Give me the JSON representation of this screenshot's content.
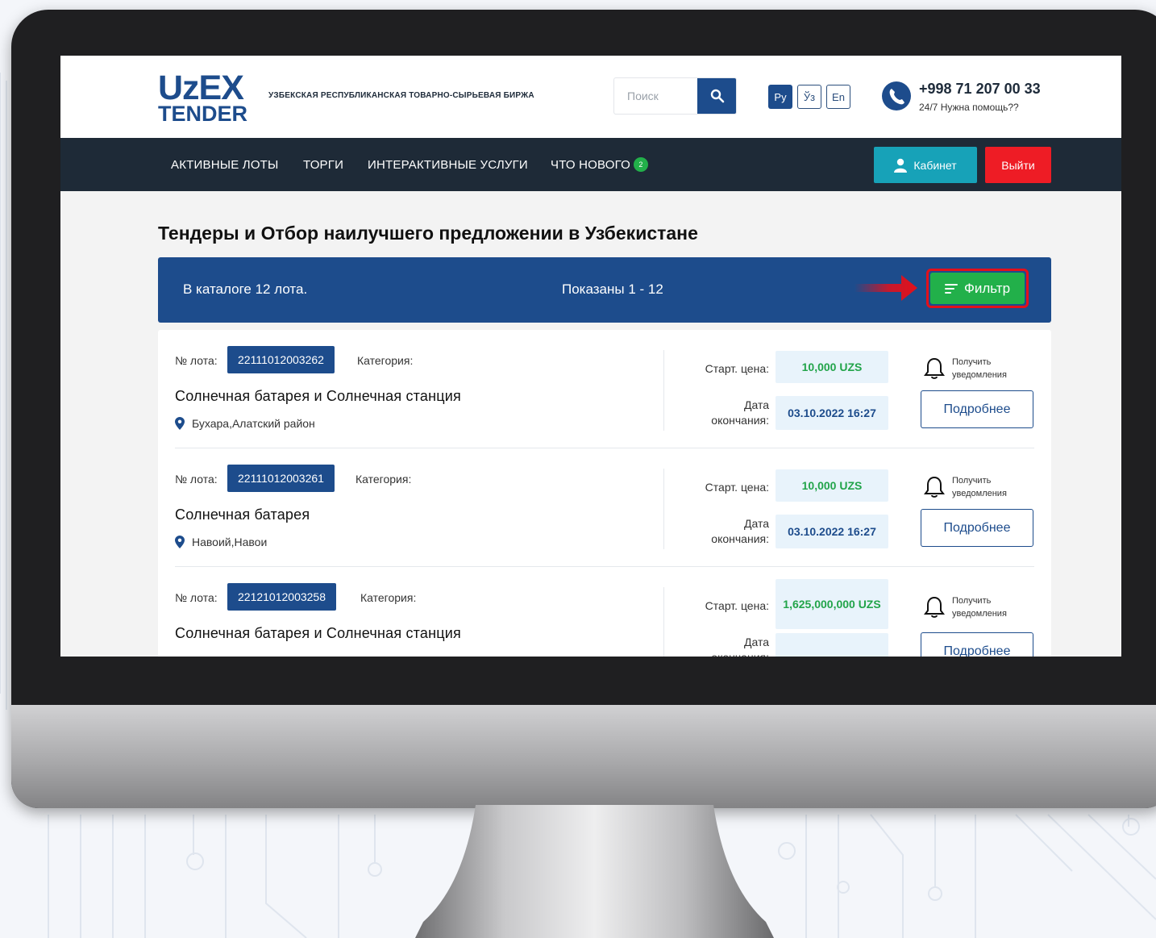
{
  "header": {
    "logo_top": "UzEX",
    "logo_bottom": "TENDER",
    "exchange_name": "УЗБЕКСКАЯ РЕСПУБЛИКАНСКАЯ ТОВАРНО-СЫРЬЕВАЯ БИРЖА",
    "search_placeholder": "Поиск",
    "languages": [
      "Ру",
      "Ўз",
      "En"
    ],
    "phone": "+998 71 207 00 33",
    "help_text": "24/7 Нужна помощь??"
  },
  "nav": {
    "items": [
      "АКТИВНЫЕ ЛОТЫ",
      "ТОРГИ",
      "ИНТЕРАКТИВНЫЕ УСЛУГИ",
      "ЧТО НОВОГО"
    ],
    "news_badge": "2",
    "cabinet_label": "Кабинет",
    "logout_label": "Выйти"
  },
  "page": {
    "title": "Тендеры и Отбор наилучшего предложении в Узбекистане",
    "catalog_count": "В каталоге 12 лота.",
    "shown": "Показаны 1 - 12",
    "filter_label": "Фильтр"
  },
  "lot_labels": {
    "lot_number": "№ лота:",
    "category": "Категория:",
    "start_price": "Старт. цена:",
    "end_date": "Дата окончания:",
    "notify": "Получить уведомления",
    "details": "Подробнее"
  },
  "lots": [
    {
      "number": "22111012003262",
      "title": "Солнечная батарея и Солнечная станция",
      "location": "Бухара,Алатский район",
      "price": "10,000 UZS",
      "end_date": "03.10.2022 16:27"
    },
    {
      "number": "22111012003261",
      "title": "Солнечная батарея",
      "location": "Навоий,Навои",
      "price": "10,000 UZS",
      "end_date": "03.10.2022 16:27"
    },
    {
      "number": "22121012003258",
      "title": "Солнечная батарея и Солнечная станция",
      "location": "",
      "price": "1,625,000,000 UZS",
      "end_date": ""
    }
  ]
}
